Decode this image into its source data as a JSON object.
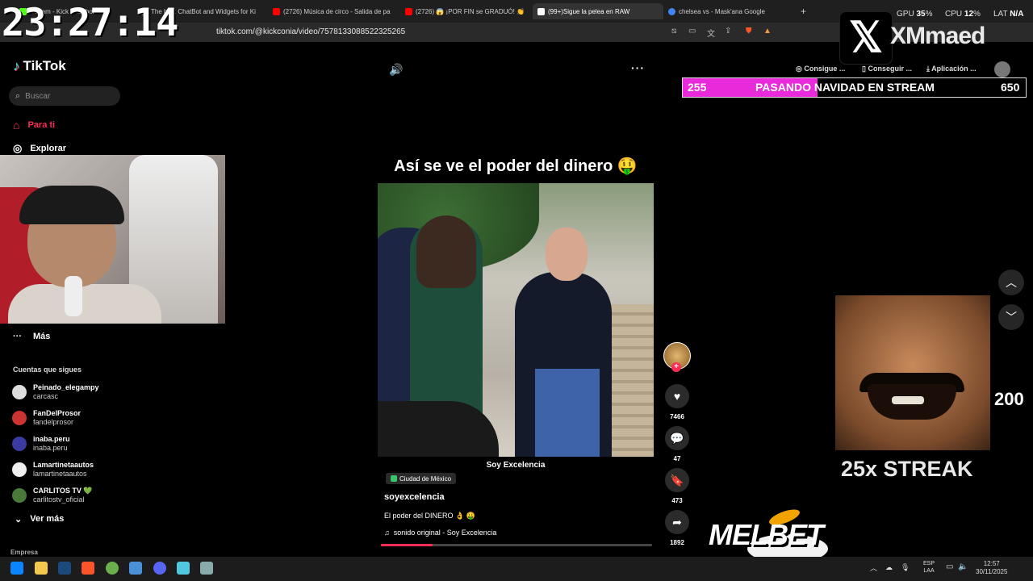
{
  "browser": {
    "tabs": [
      {
        "label": "Stream - Kick Dashboard",
        "icon": "kick-icon",
        "color": "#53fc18"
      },
      {
        "label": "The best ChatBot and Widgets for Ki",
        "icon": "widget-icon",
        "color": "#cccccc"
      },
      {
        "label": "(2726) Música de circo - Salida de pa",
        "icon": "youtube-icon",
        "color": "#ff0000"
      },
      {
        "label": "(2726) 😱 ¡POR FIN se GRADUÓ! 👏",
        "icon": "youtube-icon",
        "color": "#ff0000"
      },
      {
        "label": "(99+)Sigue la pelea en RAW",
        "icon": "tiktok-icon",
        "color": "#ffffff",
        "active": true
      },
      {
        "label": "chelsea vs - Mask'ana Google",
        "icon": "google-icon",
        "color": "#4285f4"
      }
    ],
    "new_tab": "+",
    "url": "tiktok.com/@kickconia/video/7578133088522325265"
  },
  "overlay": {
    "clock": "23:27:14",
    "gpu_label": "GPU",
    "gpu_value": "35",
    "cpu_label": "CPU",
    "cpu_value": "12",
    "lat_label": "LAT",
    "lat_value": "N/A",
    "x_handle": "XMmaed",
    "goal": {
      "current": "255",
      "title": "PASANDO NAVIDAD EN STREAM",
      "max": "650",
      "progress": 0.392,
      "color": "#e92adb"
    },
    "streak_count": "200",
    "streak_label": "25x STREAK",
    "sponsor": "MELBET"
  },
  "tiktok": {
    "brand": "TikTok",
    "search_placeholder": "Buscar",
    "nav": [
      {
        "label": "Para ti",
        "icon": "home-icon",
        "active": true
      },
      {
        "label": "Explorar",
        "icon": "compass-icon"
      }
    ],
    "more": "Más",
    "following_title": "Cuentas que sigues",
    "accounts": [
      {
        "name": "Peinado_elegampy",
        "handle": "carcasc"
      },
      {
        "name": "FanDelProsor",
        "handle": "fandelprosor"
      },
      {
        "name": "inaba.peru",
        "handle": "inaba.peru"
      },
      {
        "name": "Lamartinetaautos",
        "handle": "lamartinetaautos"
      },
      {
        "name": "CARLITOS TV 💚",
        "handle": "carlitostv_oficial"
      }
    ],
    "see_more": "Ver más",
    "company": "Empresa",
    "top_buttons": [
      "Consigue ...",
      "Conseguir ...",
      "Aplicación ..."
    ],
    "video": {
      "caption": "Así se ve el poder del dinero 🤑",
      "watermark": "Soy Excelencia",
      "location": "Ciudad de México",
      "author": "soyexcelencia",
      "description": "El poder del DINERO 👌 🤑",
      "sound": "sonido original - Soy Excelencia",
      "progress": 0.19,
      "likes": "7466",
      "comments": "47",
      "saves": "473",
      "shares": "1892"
    }
  },
  "taskbar": {
    "lang_top": "ESP",
    "lang_bottom": "LAA",
    "time": "12:57",
    "date": "30/11/2025"
  }
}
